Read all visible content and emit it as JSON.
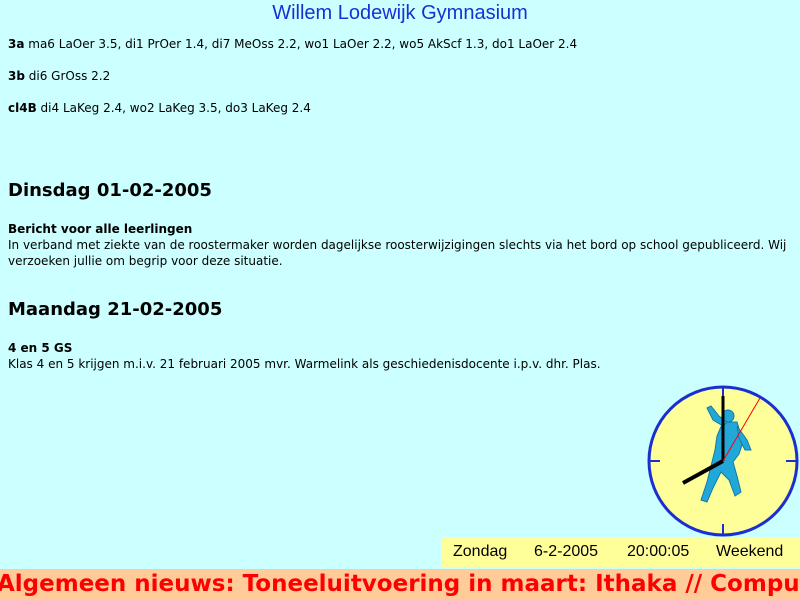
{
  "header": {
    "title": "Willem Lodewijk Gymnasium"
  },
  "changes": [
    {
      "klas": "3a",
      "detail": " ma6 LaOer 3.5, di1 PrOer 1.4, di7 MeOss 2.2, wo1 LaOer 2.2, wo5 AkScf 1.3, do1 LaOer 2.4"
    },
    {
      "klas": "3b",
      "detail": " di6 GrOss 2.2"
    },
    {
      "klas": "cl4B",
      "detail": " di4 LaKeg 2.4, wo2 LaKeg 3.5, do3 LaKeg 2.4"
    }
  ],
  "news": [
    {
      "date": "Dinsdag 01-02-2005",
      "title": "Bericht voor alle leerlingen",
      "body": "In verband met ziekte van de roostermaker worden dagelijkse roosterwijzigingen slechts via het bord op school gepubliceerd. Wij verzoeken jullie om begrip voor deze situatie."
    },
    {
      "date": "Maandag 21-02-2005",
      "title": "4 en 5 GS",
      "body": "Klas 4 en 5 krijgen m.i.v. 21 februari 2005 mvr. Warmelink als geschiedenisdocente i.p.v. dhr. Plas."
    }
  ],
  "status": {
    "day": "Zondag",
    "date": "6-2-2005",
    "time": "20:00:05",
    "week": "Weekend"
  },
  "clock": {
    "hours": 20,
    "minutes": 0,
    "seconds": 5,
    "icon": "discus-thrower-icon"
  },
  "ticker": {
    "text": "Algemeen nieuws: Toneeluitvoering in maart: Ithaka // Computerlo"
  },
  "colors": {
    "background": "#ccffff",
    "title": "#1b2fd0",
    "clock_face": "#ffff99",
    "clock_border": "#1b2fd0",
    "ticker_bg": "#ffcc99",
    "ticker_text": "#ff0000",
    "statusbar_bg": "#ffff99"
  }
}
